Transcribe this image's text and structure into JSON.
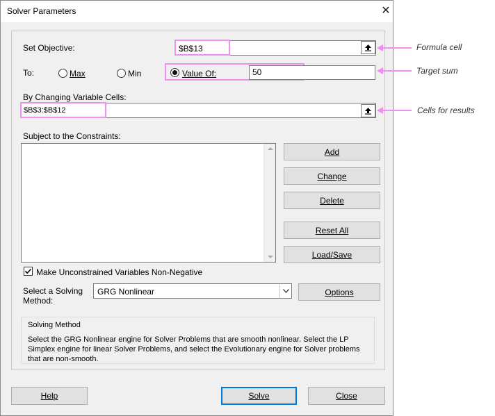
{
  "window": {
    "title": "Solver Parameters"
  },
  "objective": {
    "label": "Set Objective:",
    "value": "$B$13"
  },
  "to": {
    "label": "To:",
    "options": [
      {
        "label": "Max",
        "selected": false
      },
      {
        "label": "Min",
        "selected": false
      },
      {
        "label": "Value Of:",
        "selected": true
      }
    ],
    "value_of": "50"
  },
  "changing": {
    "label": "By Changing Variable Cells:",
    "value": "$B$3:$B$12"
  },
  "constraints": {
    "label": "Subject to the Constraints:",
    "items": [],
    "buttons": {
      "add": "Add",
      "change": "Change",
      "delete": "Delete",
      "reset_all": "Reset All",
      "load_save": "Load/Save"
    }
  },
  "nonnegative": {
    "label": "Make Unconstrained Variables Non-Negative",
    "checked": true
  },
  "method": {
    "label_line1": "Select a Solving",
    "label_line2": "Method:",
    "selected": "GRG Nonlinear",
    "options_button": "Options"
  },
  "method_group": {
    "title": "Solving Method",
    "description": "Select the GRG Nonlinear engine for Solver Problems that are smooth nonlinear. Select the LP Simplex engine for linear Solver Problems, and select the Evolutionary engine for Solver problems that are non-smooth."
  },
  "footer": {
    "help": "Help",
    "solve": "Solve",
    "close": "Close"
  },
  "annotations": {
    "formula_cell": "Formula cell",
    "target_sum": "Target sum",
    "cells_for_results": "Cells for results"
  },
  "colors": {
    "highlight": "#ef8ff0",
    "default_button_border": "#0078d7"
  },
  "icons": {
    "ref_button": "collapse-dialog-arrow-icon",
    "dropdown": "chevron-down-icon",
    "close": "close-icon",
    "check": "checkmark-icon"
  }
}
